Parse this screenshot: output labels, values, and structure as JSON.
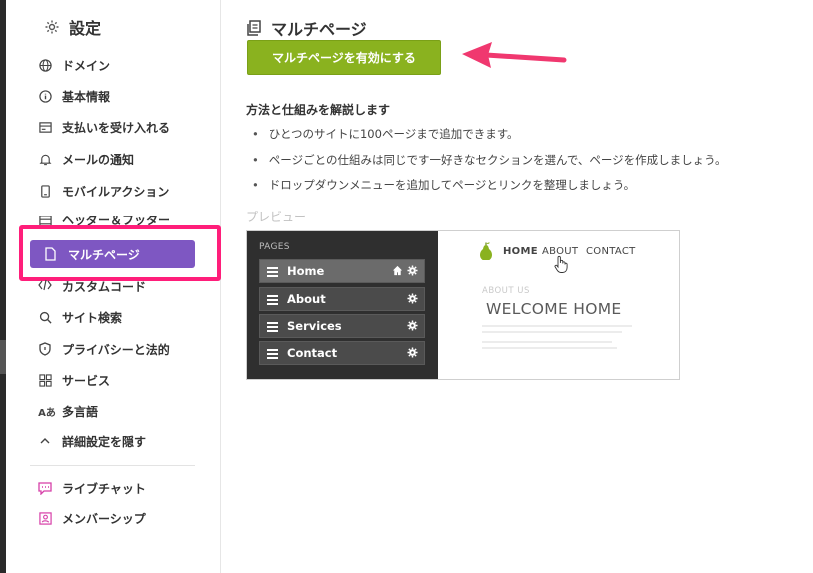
{
  "sidebar": {
    "title": "設定",
    "items": [
      {
        "label": "ドメイン",
        "icon": "globe-icon"
      },
      {
        "label": "基本情報",
        "icon": "info-icon"
      },
      {
        "label": "支払いを受け入れる",
        "icon": "payment-icon"
      },
      {
        "label": "メールの通知",
        "icon": "bell-icon"
      },
      {
        "label": "モバイルアクション",
        "icon": "mobile-icon"
      },
      {
        "label": "ヘッダー＆フッター",
        "icon": "header-footer-icon"
      },
      {
        "label": "マルチページ",
        "icon": "page-icon",
        "active": true
      },
      {
        "label": "カスタムコード",
        "icon": "code-icon"
      },
      {
        "label": "サイト検索",
        "icon": "search-icon"
      },
      {
        "label": "プライバシーと法的",
        "icon": "shield-icon"
      },
      {
        "label": "サービス",
        "icon": "grid-icon"
      },
      {
        "label": "多言語",
        "icon": "language-icon"
      },
      {
        "label": "詳細設定を隠す",
        "icon": "chevron-up-icon"
      }
    ],
    "extras": [
      {
        "label": "ライブチャット",
        "icon": "chat-icon"
      },
      {
        "label": "メンバーシップ",
        "icon": "member-icon"
      }
    ]
  },
  "main": {
    "title": "マルチページ",
    "enable_button": "マルチページを有効にする",
    "heading": "方法と仕組みを解説します",
    "bullets": [
      "ひとつのサイトに100ページまで追加できます。",
      "ページごとの仕組みは同じです一好きなセクションを選んで、ページを作成しましょう。",
      "ドロップダウンメニューを追加してページとリンクを整理しましょう。"
    ],
    "preview_label": "プレビュー"
  },
  "preview": {
    "pages_label": "PAGES",
    "pages": [
      "Home",
      "About",
      "Services",
      "Contact"
    ],
    "nav": [
      "HOME",
      "ABOUT",
      "CONTACT"
    ],
    "about_us": "ABOUT US",
    "welcome": "WELCOME HOME"
  },
  "colors": {
    "accent_purple": "#7e57c2",
    "highlight_pink": "#ff1e7a",
    "button_green": "#8ab21f",
    "logo_green": "#8ab21f"
  }
}
